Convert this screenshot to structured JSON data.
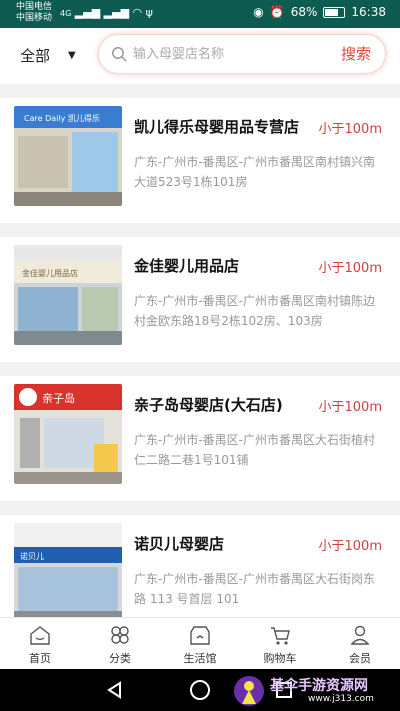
{
  "status_bar": {
    "carrier_1": "中国电信",
    "carrier_2": "中国移动",
    "signal": "4G",
    "battery": "68%",
    "time": "16:38"
  },
  "header": {
    "category": "全部",
    "search_placeholder": "输入母婴店名称",
    "search_button": "搜索"
  },
  "stores": [
    {
      "name": "凯儿得乐母婴用品专营店",
      "distance": "小于100m",
      "address": "广东-广州市-番禺区-广州市番禺区南村镇兴南大道523号1栋101房",
      "sign_text": "Care Daily 凯儿得乐"
    },
    {
      "name": "金佳婴儿用品店",
      "distance": "小于100m",
      "address": "广东-广州市-番禺区-广州市番禺区南村镇陈边村金欧东路18号2栋102房、103房",
      "sign_text": "金佳婴儿用品店"
    },
    {
      "name": "亲子岛母婴店(大石店)",
      "distance": "小于100m",
      "address": "广东-广州市-番禺区-广州市番禺区大石街植村仁二路二巷1号101铺",
      "sign_text": "亲子岛"
    },
    {
      "name": "诺贝儿母婴店",
      "distance": "小于100m",
      "address": "广东-广州市-番禺区-广州市番禺区大石街岗东路 113 号首层 101",
      "sign_text": "诺贝儿"
    }
  ],
  "tabs": [
    {
      "label": "首页",
      "icon": "home-icon"
    },
    {
      "label": "分类",
      "icon": "category-icon"
    },
    {
      "label": "生活馆",
      "icon": "lifestyle-icon"
    },
    {
      "label": "购物车",
      "icon": "cart-icon"
    },
    {
      "label": "会员",
      "icon": "member-icon"
    }
  ],
  "watermark": {
    "text": "基伞手游资源网",
    "url": "www.j313.com"
  },
  "colors": {
    "status_bar": "#0e5b52",
    "accent_red": "#d0403a",
    "search_button": "#e0463f"
  }
}
